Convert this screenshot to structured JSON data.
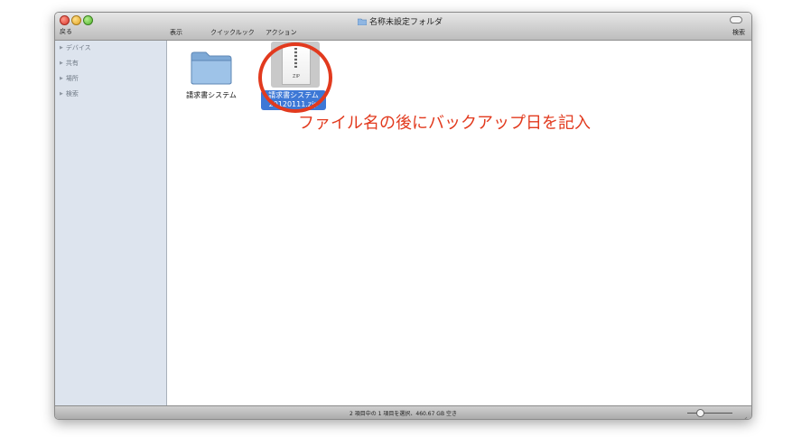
{
  "window": {
    "title": "名称未設定フォルダ",
    "toolbar": {
      "back_label": "戻る",
      "view_label": "表示",
      "quicklook_label": "クイックルック",
      "action_label": "アクション",
      "search_label": "検索"
    }
  },
  "sidebar": {
    "items": [
      {
        "label": "デバイス"
      },
      {
        "label": "共有"
      },
      {
        "label": "場所"
      },
      {
        "label": "検索"
      }
    ]
  },
  "files": [
    {
      "name": "請求書システム",
      "icon": "folder-icon",
      "selected": false
    },
    {
      "name_line1": "請求書システム",
      "name_line2": "20120111.zip",
      "icon": "zip-file-icon",
      "icon_text": "ZIP",
      "selected": true
    }
  ],
  "status": {
    "text": "2 項目中の 1 項目を選択、460.67 GB 空き"
  },
  "annotation": {
    "text": "ファイル名の後にバックアップ日を記入",
    "color": "#e23a1e"
  },
  "colors": {
    "selection": "#3d78d6",
    "sidebar_bg": "#dde4ee"
  }
}
